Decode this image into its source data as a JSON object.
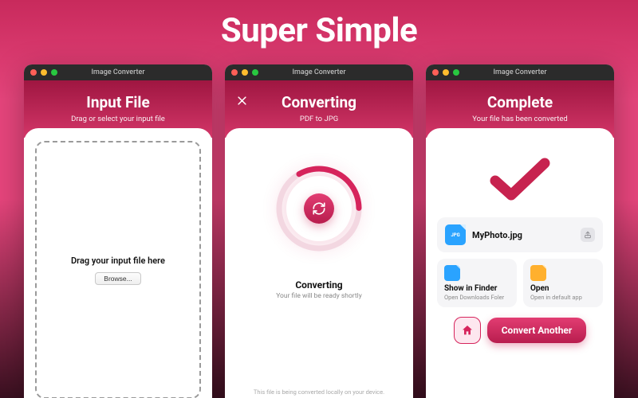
{
  "hero": "Super Simple",
  "window_title": "Image Converter",
  "colors": {
    "brand": "#d6245c"
  },
  "screens": {
    "input": {
      "title": "Input File",
      "subtitle": "Drag or select your input file",
      "dropzone_text": "Drag your input file here",
      "browse_label": "Browse..."
    },
    "converting": {
      "title": "Converting",
      "subtitle": "PDF to JPG",
      "status_title": "Converting",
      "status_sub": "Your file will be ready shortly",
      "footnote": "This file is being converted locally on your device."
    },
    "complete": {
      "title": "Complete",
      "subtitle": "Your file has been converted",
      "file": {
        "name": "MyPhoto.jpg",
        "badge": "JPG"
      },
      "actions": {
        "finder": {
          "title": "Show in Finder",
          "sub": "Open Downloads Foler"
        },
        "open": {
          "title": "Open",
          "sub": "Open in default app"
        }
      },
      "convert_another": "Convert Another"
    }
  }
}
